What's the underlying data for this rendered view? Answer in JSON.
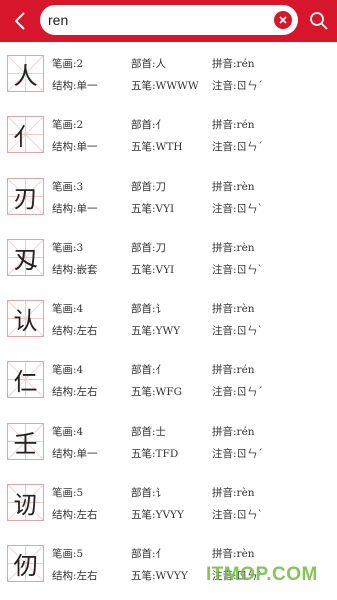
{
  "search": {
    "query": "ren"
  },
  "labels": {
    "strokes": "笔画:",
    "radical": "部首:",
    "pinyin": "拼音:",
    "structure": "结构:",
    "wubi": "五笔:",
    "zhuyin": "注音:"
  },
  "results": [
    {
      "char": "人",
      "strokes": "2",
      "radical": "人",
      "pinyin": "rén",
      "structure": "单一",
      "wubi": "WWWW",
      "zhuyin": "ㄖㄣˊ"
    },
    {
      "char": "亻",
      "strokes": "2",
      "radical": "亻",
      "pinyin": "rén",
      "structure": "单一",
      "wubi": "WTH",
      "zhuyin": "ㄖㄣˊ"
    },
    {
      "char": "刃",
      "strokes": "3",
      "radical": "刀",
      "pinyin": "rèn",
      "structure": "单一",
      "wubi": "VYI",
      "zhuyin": "ㄖㄣˋ"
    },
    {
      "char": "刄",
      "strokes": "3",
      "radical": "刀",
      "pinyin": "rèn",
      "structure": "嵌套",
      "wubi": "VYI",
      "zhuyin": "ㄖㄣˋ"
    },
    {
      "char": "认",
      "strokes": "4",
      "radical": "讠",
      "pinyin": "rèn",
      "structure": "左右",
      "wubi": "YWY",
      "zhuyin": "ㄖㄣˋ"
    },
    {
      "char": "仁",
      "strokes": "4",
      "radical": "亻",
      "pinyin": "rén",
      "structure": "左右",
      "wubi": "WFG",
      "zhuyin": "ㄖㄣˊ"
    },
    {
      "char": "壬",
      "strokes": "4",
      "radical": "士",
      "pinyin": "rén",
      "structure": "单一",
      "wubi": "TFD",
      "zhuyin": "ㄖㄣˊ"
    },
    {
      "char": "讱",
      "strokes": "5",
      "radical": "讠",
      "pinyin": "rèn",
      "structure": "左右",
      "wubi": "YVYY",
      "zhuyin": "ㄖㄣˋ"
    },
    {
      "char": "仞",
      "strokes": "5",
      "radical": "亻",
      "pinyin": "rèn",
      "structure": "左右",
      "wubi": "WVYY",
      "zhuyin": "ㄖㄣˋ"
    }
  ],
  "watermark": "ITMOP.COM",
  "colors": {
    "accent": "#d7162b",
    "grid": "#e4a3a3",
    "watermark": "#78be46"
  }
}
